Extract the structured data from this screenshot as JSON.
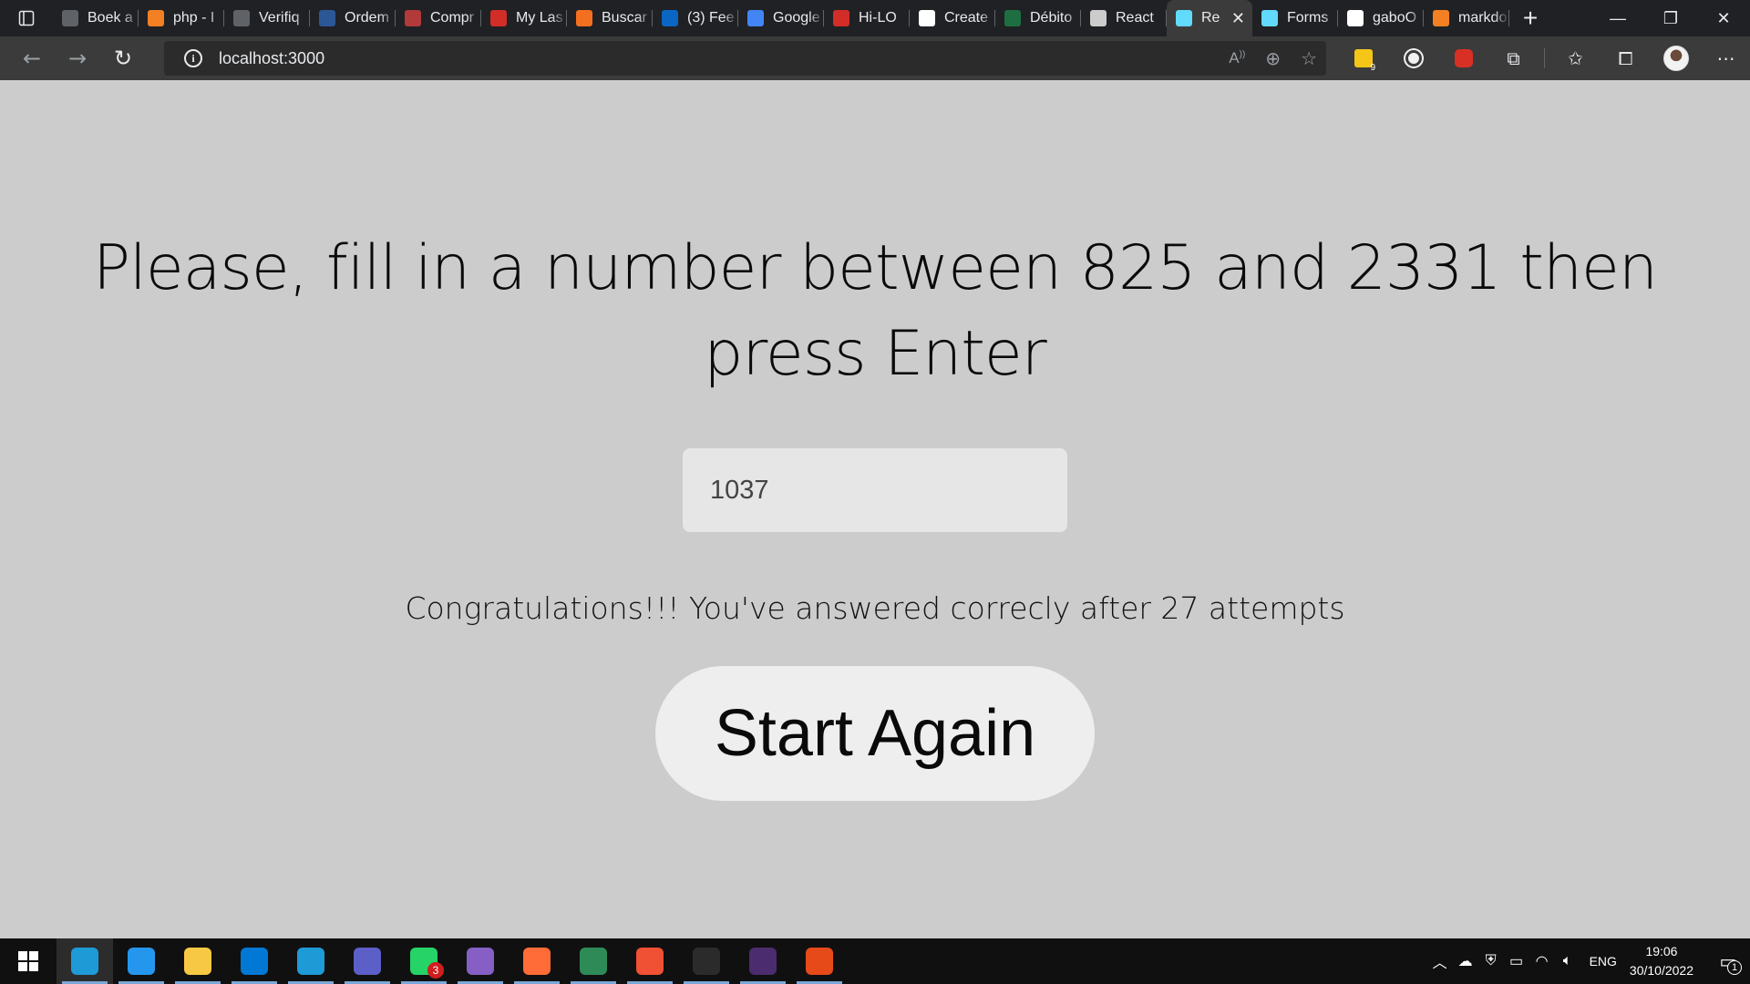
{
  "browser": {
    "tabs": [
      {
        "label": "Boek a",
        "icon": "page-icon",
        "color": "#5f6368"
      },
      {
        "label": "php - I",
        "icon": "stackoverflow-icon",
        "color": "#f48024"
      },
      {
        "label": "Verifiq",
        "icon": "page-icon",
        "color": "#5f6368"
      },
      {
        "label": "Ordem",
        "icon": "globe-icon",
        "color": "#2b5797"
      },
      {
        "label": "Compr",
        "icon": "pdf-icon",
        "color": "#b23a3a"
      },
      {
        "label": "My Las",
        "icon": "lastpass-icon",
        "color": "#d32d27"
      },
      {
        "label": "Buscar",
        "icon": "shop-icon",
        "color": "#f37021"
      },
      {
        "label": "(3) Fee",
        "icon": "linkedin-icon",
        "color": "#0a66c2"
      },
      {
        "label": "Google",
        "icon": "google-translate-icon",
        "color": "#4285f4"
      },
      {
        "label": "Hi-LO",
        "icon": "pdf-icon",
        "color": "#d32d27"
      },
      {
        "label": "Create",
        "icon": "github-icon",
        "color": "#ffffff"
      },
      {
        "label": "Débito",
        "icon": "excel-icon",
        "color": "#1d6f42"
      },
      {
        "label": "React",
        "icon": "avatar-page-icon",
        "color": "#cccccc"
      },
      {
        "label": "Re",
        "icon": "react-icon",
        "color": "#61dafb",
        "active": true
      },
      {
        "label": "Forms",
        "icon": "react-icon",
        "color": "#61dafb"
      },
      {
        "label": "gaboO",
        "icon": "github-icon",
        "color": "#ffffff"
      },
      {
        "label": "markdo",
        "icon": "stackoverflow-icon",
        "color": "#f48024"
      }
    ],
    "new_tab_label": "+",
    "address": "localhost:3000",
    "extension_badge": "9"
  },
  "page": {
    "headline": "Please, fill in a number between 825 and 2331 then press Enter",
    "input_value": "1037",
    "result_message": "Congratulations!!! You've answered correcly after 27 attempts",
    "button_label": "Start Again"
  },
  "taskbar": {
    "apps": [
      {
        "name": "edge-icon",
        "color": "#1e9ad6",
        "active": true
      },
      {
        "name": "vscode-icon",
        "color": "#2496ed"
      },
      {
        "name": "file-explorer-icon",
        "color": "#f7c843"
      },
      {
        "name": "outlook-icon",
        "color": "#0078d4"
      },
      {
        "name": "edge-dev-icon",
        "color": "#1e9ad6"
      },
      {
        "name": "teams-icon",
        "color": "#5b5fc7"
      },
      {
        "name": "whatsapp-icon",
        "color": "#25d366",
        "badge": "3"
      },
      {
        "name": "visual-studio-icon",
        "color": "#865fc5"
      },
      {
        "name": "postman-icon",
        "color": "#ff6c37"
      },
      {
        "name": "app-icon",
        "color": "#2e8b57"
      },
      {
        "name": "git-icon",
        "color": "#f05033"
      },
      {
        "name": "terminal-icon",
        "color": "#2b2b2b"
      },
      {
        "name": "powershell-dev-icon",
        "color": "#4b2c6e"
      },
      {
        "name": "snipping-tool-icon",
        "color": "#e64a19"
      }
    ],
    "language": "ENG",
    "time": "19:06",
    "date": "30/10/2022",
    "notification_count": "1"
  }
}
